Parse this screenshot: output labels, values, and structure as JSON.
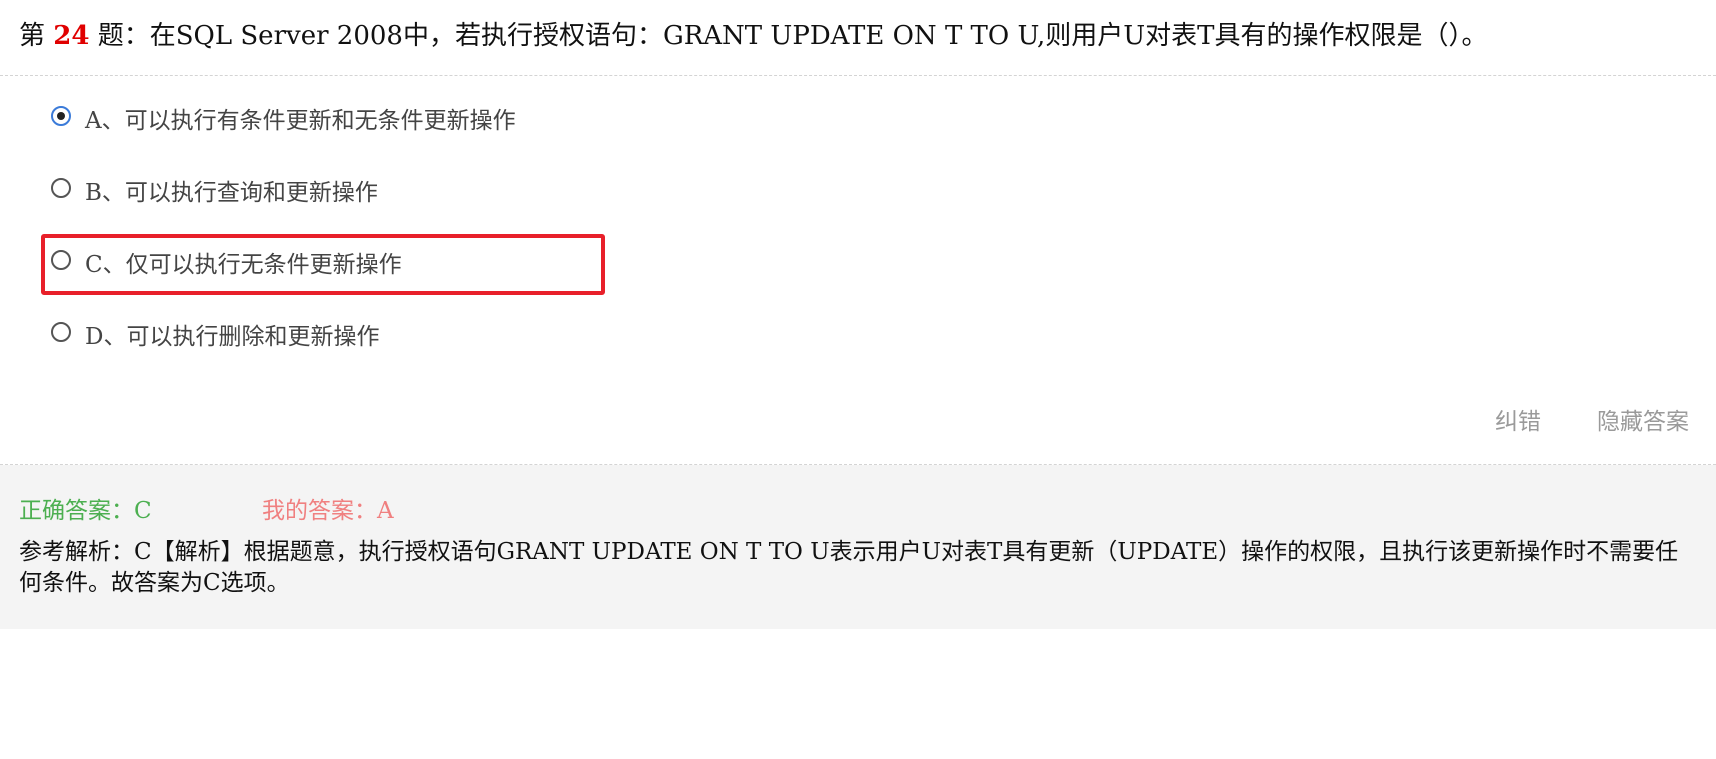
{
  "question": {
    "prefix": "第 ",
    "number": "24",
    "text": " 题：在SQL Server 2008中，若执行授权语句：GRANT UPDATE ON T TO U,则用户U对表T具有的操作权限是（）。"
  },
  "options": [
    {
      "label": "A、可以执行有条件更新和无条件更新操作",
      "checked": true
    },
    {
      "label": "B、可以执行查询和更新操作",
      "checked": false
    },
    {
      "label": "C、仅可以执行无条件更新操作",
      "checked": false
    },
    {
      "label": "D、可以执行删除和更新操作",
      "checked": false
    }
  ],
  "actions": {
    "report_error": "纠错",
    "hide_answer": "隐藏答案"
  },
  "answer": {
    "correct": "正确答案：C",
    "mine": "我的答案：A",
    "analysis": "参考解析：C【解析】根据题意，执行授权语句GRANT UPDATE ON T TO U表示用户U对表T具有更新（UPDATE）操作的权限，且执行该更新操作时不需要任何条件。故答案为C选项。"
  },
  "colors": {
    "question_number": "#e00000",
    "correct_answer": "#4caf50",
    "my_answer": "#f08080",
    "highlight_box": "#e8202a",
    "radio_selected_border": "#3b7bd9"
  },
  "icons": [
    "radio-selected-icon",
    "radio-unselected-icon"
  ]
}
